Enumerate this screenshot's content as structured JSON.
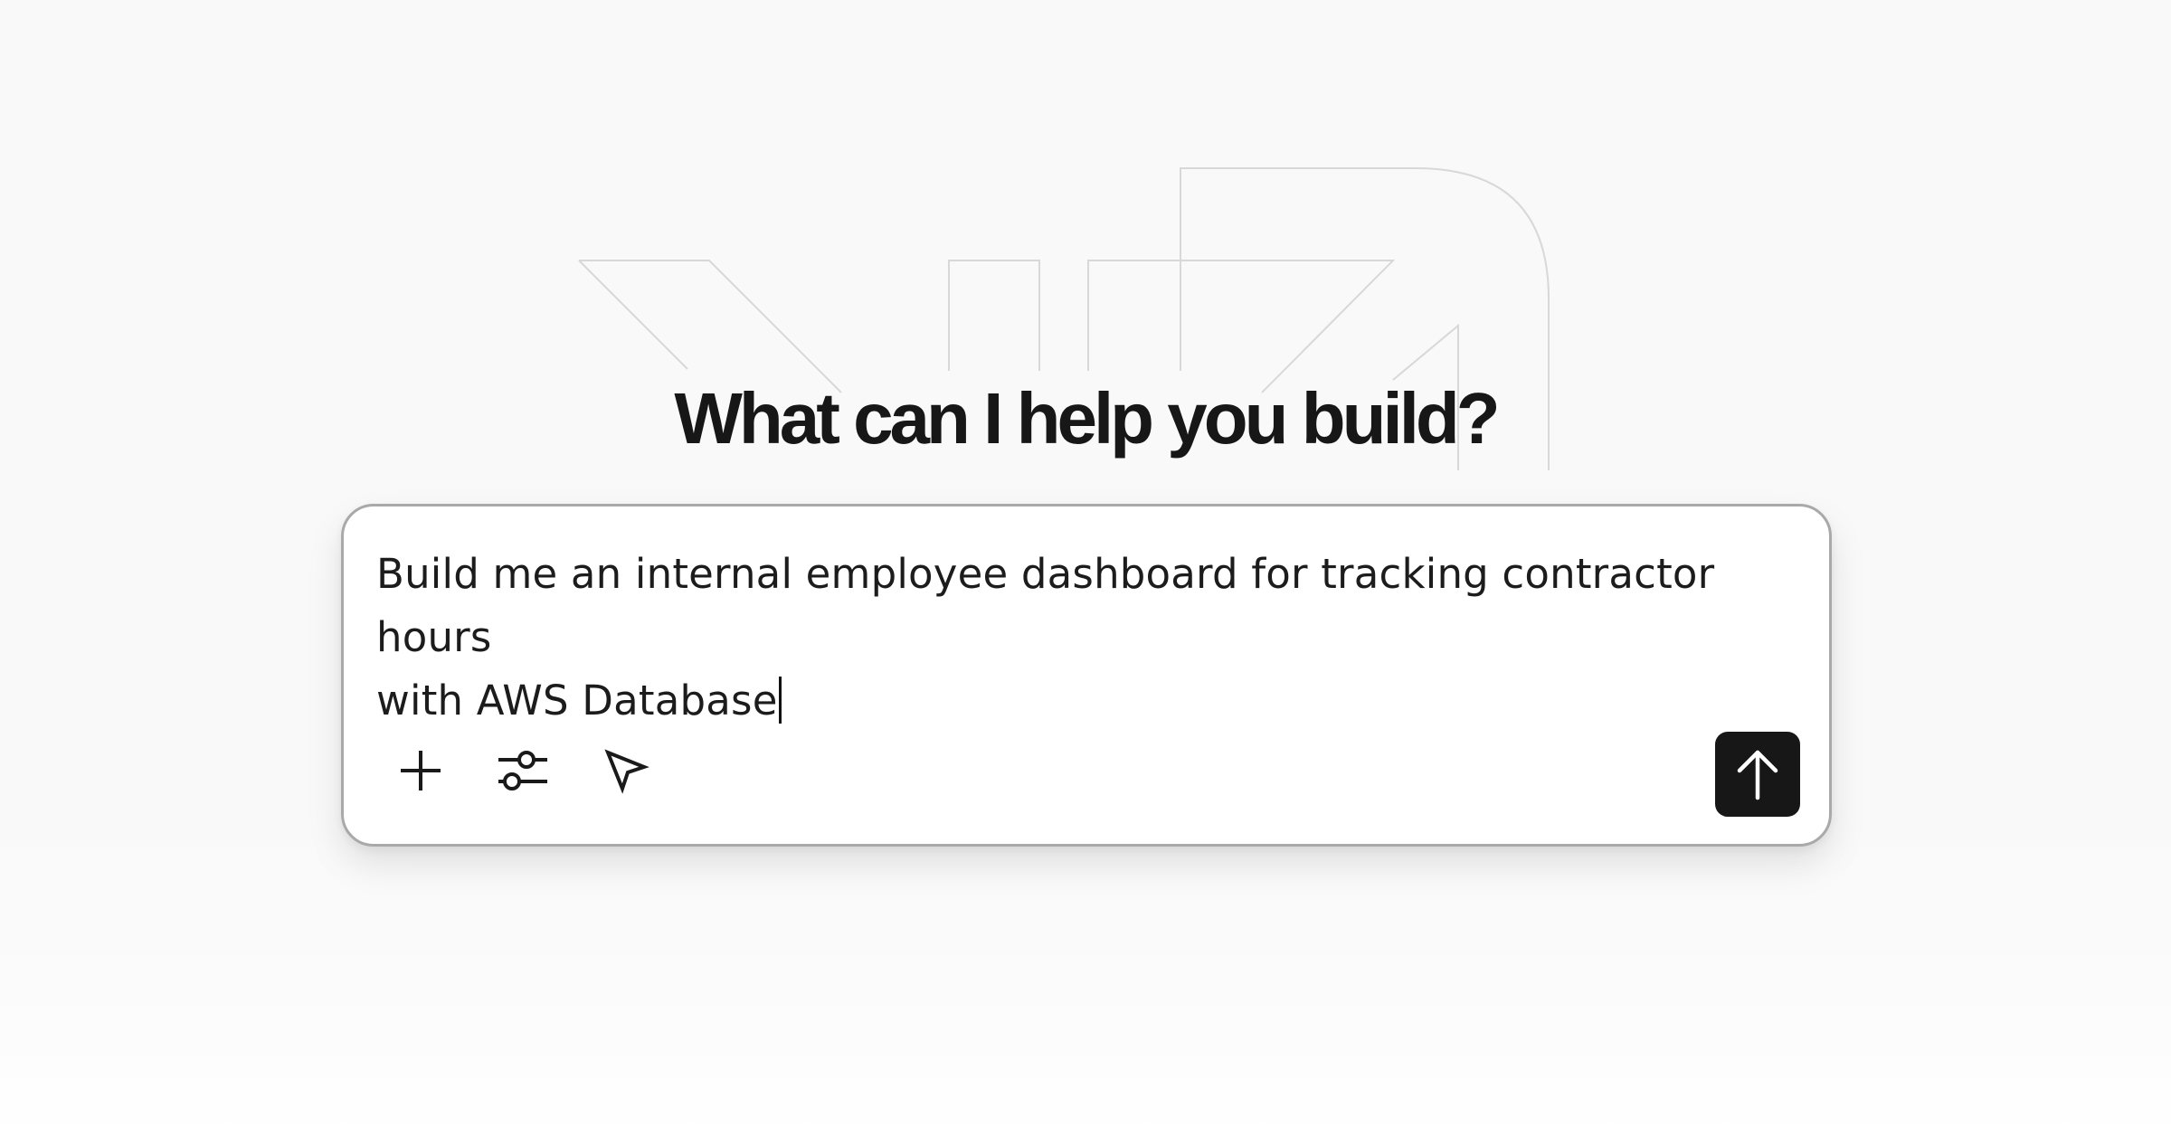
{
  "headline": "What can I help you build?",
  "prompt": {
    "text_line1": "Build me an internal employee dashboard for tracking contractor hours",
    "text_line2": "with AWS Database"
  },
  "toolbar": {
    "icons": [
      "plus-icon",
      "sliders-icon",
      "cursor-pointer-icon"
    ],
    "send_icon": "arrow-up-icon"
  },
  "colors": {
    "background": "#f9f9f9",
    "card": "#ffffff",
    "card_border": "#a9a9a9",
    "text": "#171717",
    "send_button": "#171717"
  }
}
